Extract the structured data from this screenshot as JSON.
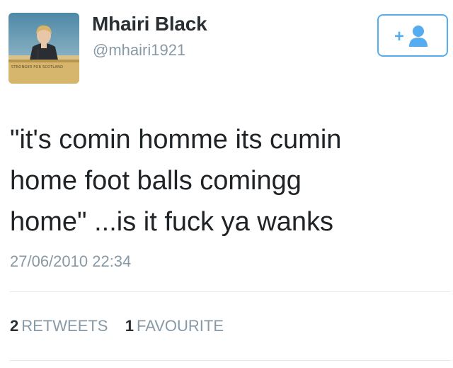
{
  "user": {
    "name": "Mhairi Black",
    "handle": "@mhairi1921",
    "avatar_banner_text": "STRONGER FOR SCOTLAND"
  },
  "follow_button": {
    "icon": "add-user-icon",
    "icon_text": "+"
  },
  "tweet": {
    "text": "\"it's comin homme its cumin\nhome foot balls comingg\nhome\" ...is it fuck ya wanks",
    "timestamp": "27/06/2010 22:34"
  },
  "stats": {
    "retweets_count": "2",
    "retweets_label": "RETWEETS",
    "favourites_count": "1",
    "favourites_label": "FAVOURITE"
  },
  "colors": {
    "accent": "#55acee",
    "muted_text": "#8899a6",
    "name_text": "#292f33",
    "divider": "#e1e8ed"
  }
}
